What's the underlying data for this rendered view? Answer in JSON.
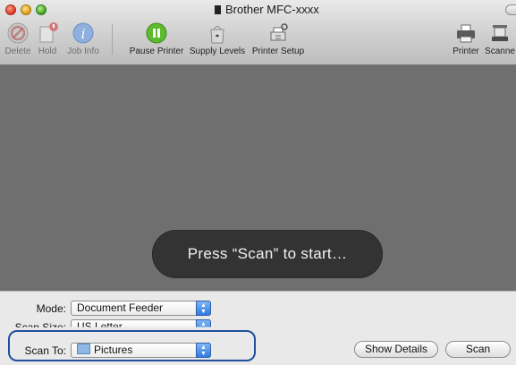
{
  "window": {
    "title": "Brother MFC-xxxx"
  },
  "toolbar": {
    "items": [
      {
        "label": "Delete",
        "icon": "delete-icon",
        "enabled": false
      },
      {
        "label": "Hold",
        "icon": "hold-icon",
        "enabled": false
      },
      {
        "label": "Job Info",
        "icon": "info-icon",
        "enabled": false
      },
      {
        "label": "Pause Printer",
        "icon": "pause-icon",
        "enabled": true
      },
      {
        "label": "Supply Levels",
        "icon": "supply-levels-icon",
        "enabled": true
      },
      {
        "label": "Printer Setup",
        "icon": "printer-setup-icon",
        "enabled": true
      },
      {
        "label": "Printer",
        "icon": "printer-icon",
        "enabled": true
      },
      {
        "label": "Scanne",
        "icon": "scanner-icon",
        "enabled": true
      }
    ]
  },
  "preview": {
    "message": "Press “Scan” to start…"
  },
  "settings": {
    "mode_label": "Mode:",
    "mode_value": "Document Feeder",
    "scan_size_label": "Scan Size:",
    "scan_size_value": "US Letter",
    "scan_to_label": "Scan To:",
    "scan_to_value": "Pictures"
  },
  "buttons": {
    "show_details": "Show Details",
    "scan": "Scan"
  },
  "colors": {
    "highlight": "#1f4f9c",
    "preview_bg": "#6f6f6f",
    "hud_bg": "#333333"
  }
}
